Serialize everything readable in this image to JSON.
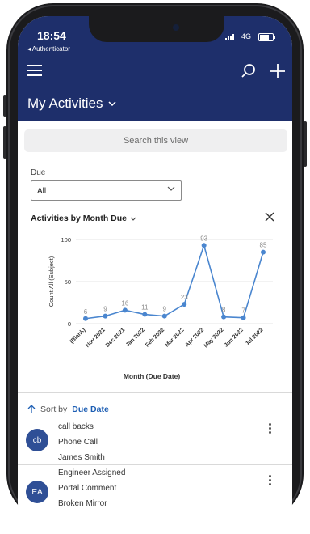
{
  "status": {
    "time": "18:54",
    "back_app": "◂ Authenticator",
    "network": "4G"
  },
  "header": {
    "view_title": "My Activities"
  },
  "search": {
    "placeholder": "Search this view"
  },
  "filter": {
    "label": "Due",
    "value": "All"
  },
  "chart_card": {
    "title": "Activities by Month Due"
  },
  "chart_data": {
    "type": "line",
    "xlabel": "Month (Due Date)",
    "ylabel": "Count:All (Subject)",
    "ylim": [
      0,
      100
    ],
    "yticks": [
      0,
      50,
      100
    ],
    "categories": [
      "(Blank)",
      "Nov 2021",
      "Dec 2021",
      "Jan 2022",
      "Feb 2022",
      "Mar 2022",
      "Apr 2022",
      "May 2022",
      "Jun 2022",
      "Jul 2022"
    ],
    "values": [
      6,
      9,
      16,
      11,
      9,
      23,
      93,
      8,
      7,
      85
    ],
    "data_labels": [
      "6",
      "9",
      "16",
      "11",
      "9",
      "23",
      "93",
      "8",
      "7",
      "85"
    ],
    "grid": true,
    "color": "#4a86cf"
  },
  "sort": {
    "prefix": "Sort by",
    "field": "Due Date"
  },
  "activities": [
    {
      "initials": "cb",
      "subject": "call backs",
      "type": "Phone Call",
      "regarding": "James Smith"
    },
    {
      "initials": "EA",
      "subject": "Engineer Assigned",
      "type": "Portal Comment",
      "regarding": "Broken Mirror"
    }
  ],
  "colors": {
    "header_bg": "#1e2f6b",
    "accent": "#1e5fb4",
    "avatar": "#2f4f96"
  }
}
